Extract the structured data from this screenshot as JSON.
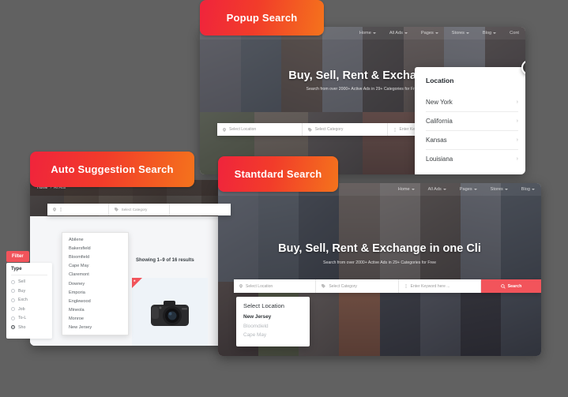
{
  "background_color": "#616161",
  "accent_color": "#f2545b",
  "ribbon_gradient": [
    "#f0243c",
    "#f4731c"
  ],
  "tabs": {
    "popup": "Popup Search",
    "auto": "Auto Suggestion Search",
    "standard": "Stantdard Search"
  },
  "site_nav": {
    "items": [
      {
        "label": "Home",
        "caret": true
      },
      {
        "label": "All Ads",
        "caret": true
      },
      {
        "label": "Pages",
        "caret": true
      },
      {
        "label": "Stores",
        "caret": true
      },
      {
        "label": "Blog",
        "caret": true
      },
      {
        "label": "Cont",
        "caret": false
      }
    ]
  },
  "hero": {
    "title_popup": "Buy, Sell, Rent & Exchange",
    "title_standard": "Buy, Sell, Rent & Exchange in one Cli",
    "subtitle": "Search from over 2000+ Active Ads in 29+ Categories for Free"
  },
  "searchbar": {
    "location_placeholder": "Select Location",
    "category_placeholder": "Select Category",
    "keyword_placeholder": "Enter Keyword here ...",
    "button_label": "Search",
    "location_icon": "map-pin-icon",
    "category_icon": "tag-icon",
    "keyword_icon": "text-cursor-icon",
    "search_icon": "magnifier-icon"
  },
  "location_popup": {
    "title": "Location",
    "close_label": "x",
    "chevron": "›",
    "items": [
      {
        "label": "New York"
      },
      {
        "label": "California"
      },
      {
        "label": "Kansas"
      },
      {
        "label": "Louisiana"
      }
    ]
  },
  "auto_card": {
    "breadcrumb": {
      "home": "Home",
      "separator": "›",
      "current": "All Ads"
    },
    "filter_button": "Filter",
    "facet_title": "Type",
    "facet_options": [
      {
        "label": "Sell",
        "selected": false
      },
      {
        "label": "Buy",
        "selected": false
      },
      {
        "label": "Exch",
        "selected": false
      },
      {
        "label": "Job",
        "selected": false
      },
      {
        "label": "To-L",
        "selected": false
      },
      {
        "label": "Sho",
        "selected": true
      }
    ],
    "results_count": "Showing 1–9 of 16 results",
    "suggestions": [
      "Abilene",
      "Bakersfield",
      "Bloomfield",
      "Cape May",
      "Claremont",
      "Downey",
      "Emporia",
      "Englewood",
      "Mineola",
      "Monroe",
      "New Jersey"
    ],
    "product": {
      "badge_icon": "star-ribbon-icon",
      "image_alt": "dslr-camera"
    }
  },
  "location_dropdown": {
    "title": "Select Location",
    "items": [
      {
        "label": "New Jersey",
        "selected": true
      },
      {
        "label": "Bloomdield",
        "selected": false
      },
      {
        "label": "Cape May",
        "selected": false
      }
    ]
  },
  "collage_colors": {
    "popup": [
      "#8b8f96",
      "#6f7d86",
      "#7d6f62",
      "#9aa0a6",
      "#5f5a56",
      "#8a7f74",
      "#a3a8ad",
      "#6b6258"
    ],
    "popup_bottom": [
      "#7c8a6e",
      "#9a8f7e",
      "#6f6a65",
      "#8b6f63",
      "#4e5a62",
      "#8d8378"
    ],
    "standard": [
      "#7b8690",
      "#6c7a84",
      "#4f5a63",
      "#8b7f72",
      "#a09a91",
      "#6e655c",
      "#8c939a",
      "#5d6a73"
    ],
    "standard_bottom": [
      "#5c5048",
      "#6f7a55",
      "#7a6f66",
      "#b06a4a",
      "#3c4148",
      "#5a6168",
      "#2f3136",
      "#4a5560"
    ]
  }
}
